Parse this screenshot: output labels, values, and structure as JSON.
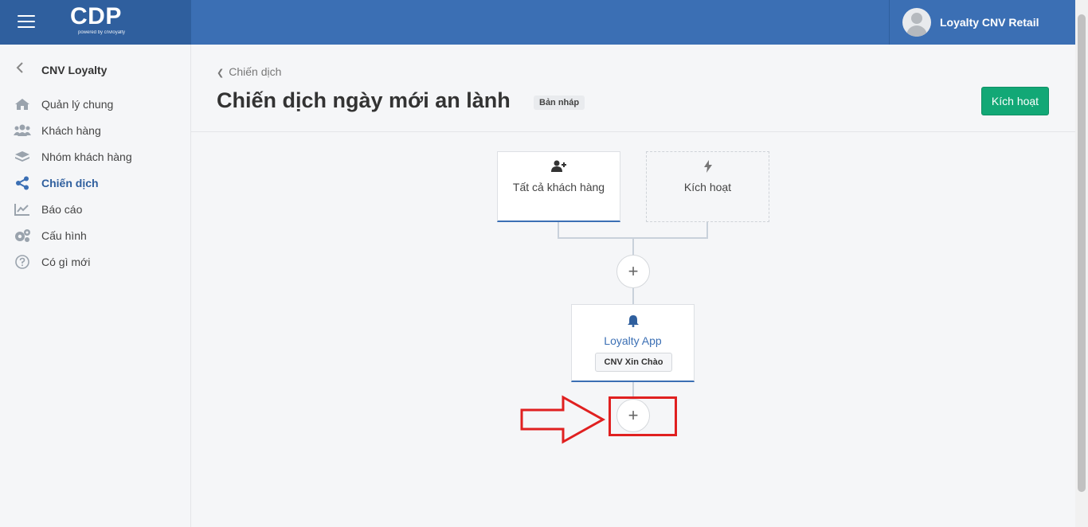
{
  "header": {
    "logo_text": "CDP",
    "logo_sub": "powered by cnvloyalty",
    "user_name": "Loyalty CNV Retail"
  },
  "sidebar": {
    "back_title": "CNV Loyalty",
    "items": [
      {
        "label": "Quản lý chung",
        "icon": "home-icon"
      },
      {
        "label": "Khách hàng",
        "icon": "users-icon"
      },
      {
        "label": "Nhóm khách hàng",
        "icon": "layers-icon"
      },
      {
        "label": "Chiến dịch",
        "icon": "share-icon",
        "active": true
      },
      {
        "label": "Báo cáo",
        "icon": "chart-icon"
      },
      {
        "label": "Cấu hình",
        "icon": "gears-icon"
      },
      {
        "label": "Có gì mới",
        "icon": "question-icon"
      }
    ]
  },
  "page": {
    "breadcrumb": "Chiến dịch",
    "title": "Chiến dịch ngày mới an lành",
    "status_badge": "Bản nháp",
    "activate_button": "Kích hoạt"
  },
  "flow": {
    "trigger_node": "Tất cả khách hàng",
    "activate_node": "Kích hoạt",
    "app_node": "Loyalty App",
    "app_tag": "CNV Xin Chào",
    "add_symbol": "+"
  },
  "colors": {
    "header_bg": "#3b6fb4",
    "brand_bg": "#2f5f9e",
    "accent": "#3b6fb4",
    "button_green": "#12a876",
    "annotation_red": "#e02020"
  }
}
